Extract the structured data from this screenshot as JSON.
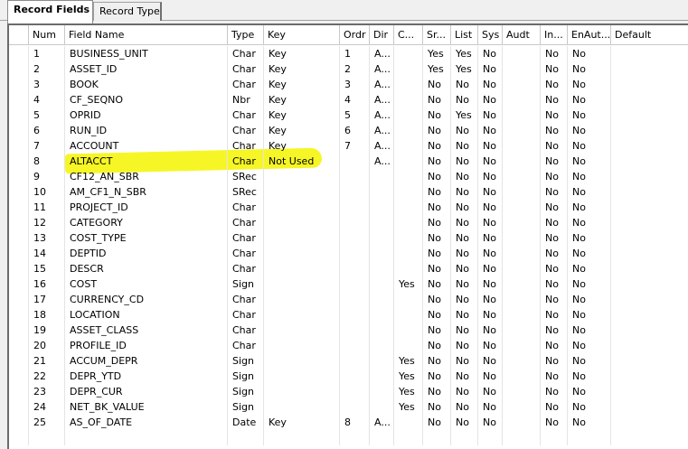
{
  "tabs": {
    "active": "Record Fields",
    "inactive": "Record Type"
  },
  "columns": [
    "Num",
    "Field Name",
    "Type",
    "Key",
    "Ordr",
    "Dir",
    "C...",
    "Sr...",
    "List",
    "Sys",
    "Audt",
    "In...",
    "EnAut...",
    "Default"
  ],
  "rows": [
    [
      "1",
      "BUSINESS_UNIT",
      "Char",
      "Key",
      "1",
      "A...",
      "",
      "Yes",
      "Yes",
      "No",
      "",
      "No",
      "No",
      ""
    ],
    [
      "2",
      "ASSET_ID",
      "Char",
      "Key",
      "2",
      "A...",
      "",
      "Yes",
      "Yes",
      "No",
      "",
      "No",
      "No",
      ""
    ],
    [
      "3",
      "BOOK",
      "Char",
      "Key",
      "3",
      "A...",
      "",
      "No",
      "No",
      "No",
      "",
      "No",
      "No",
      ""
    ],
    [
      "4",
      "CF_SEQNO",
      "Nbr",
      "Key",
      "4",
      "A...",
      "",
      "No",
      "No",
      "No",
      "",
      "No",
      "No",
      ""
    ],
    [
      "5",
      "OPRID",
      "Char",
      "Key",
      "5",
      "A...",
      "",
      "No",
      "Yes",
      "No",
      "",
      "No",
      "No",
      ""
    ],
    [
      "6",
      "RUN_ID",
      "Char",
      "Key",
      "6",
      "A...",
      "",
      "No",
      "No",
      "No",
      "",
      "No",
      "No",
      ""
    ],
    [
      "7",
      "ACCOUNT",
      "Char",
      "Key",
      "7",
      "A...",
      "",
      "No",
      "No",
      "No",
      "",
      "No",
      "No",
      ""
    ],
    [
      "8",
      "ALTACCT",
      "Char",
      "Not Used",
      "",
      "A...",
      "",
      "No",
      "No",
      "No",
      "",
      "No",
      "No",
      ""
    ],
    [
      "9",
      "CF12_AN_SBR",
      "SRec",
      "",
      "",
      "",
      "",
      "No",
      "No",
      "No",
      "",
      "No",
      "No",
      ""
    ],
    [
      "10",
      "AM_CF1_N_SBR",
      "SRec",
      "",
      "",
      "",
      "",
      "No",
      "No",
      "No",
      "",
      "No",
      "No",
      ""
    ],
    [
      "11",
      "PROJECT_ID",
      "Char",
      "",
      "",
      "",
      "",
      "No",
      "No",
      "No",
      "",
      "No",
      "No",
      ""
    ],
    [
      "12",
      "CATEGORY",
      "Char",
      "",
      "",
      "",
      "",
      "No",
      "No",
      "No",
      "",
      "No",
      "No",
      ""
    ],
    [
      "13",
      "COST_TYPE",
      "Char",
      "",
      "",
      "",
      "",
      "No",
      "No",
      "No",
      "",
      "No",
      "No",
      ""
    ],
    [
      "14",
      "DEPTID",
      "Char",
      "",
      "",
      "",
      "",
      "No",
      "No",
      "No",
      "",
      "No",
      "No",
      ""
    ],
    [
      "15",
      "DESCR",
      "Char",
      "",
      "",
      "",
      "",
      "No",
      "No",
      "No",
      "",
      "No",
      "No",
      ""
    ],
    [
      "16",
      "COST",
      "Sign",
      "",
      "",
      "",
      "Yes",
      "No",
      "No",
      "No",
      "",
      "No",
      "No",
      ""
    ],
    [
      "17",
      "CURRENCY_CD",
      "Char",
      "",
      "",
      "",
      "",
      "No",
      "No",
      "No",
      "",
      "No",
      "No",
      ""
    ],
    [
      "18",
      "LOCATION",
      "Char",
      "",
      "",
      "",
      "",
      "No",
      "No",
      "No",
      "",
      "No",
      "No",
      ""
    ],
    [
      "19",
      "ASSET_CLASS",
      "Char",
      "",
      "",
      "",
      "",
      "No",
      "No",
      "No",
      "",
      "No",
      "No",
      ""
    ],
    [
      "20",
      "PROFILE_ID",
      "Char",
      "",
      "",
      "",
      "",
      "No",
      "No",
      "No",
      "",
      "No",
      "No",
      ""
    ],
    [
      "21",
      "ACCUM_DEPR",
      "Sign",
      "",
      "",
      "",
      "Yes",
      "No",
      "No",
      "No",
      "",
      "No",
      "No",
      ""
    ],
    [
      "22",
      "DEPR_YTD",
      "Sign",
      "",
      "",
      "",
      "Yes",
      "No",
      "No",
      "No",
      "",
      "No",
      "No",
      ""
    ],
    [
      "23",
      "DEPR_CUR",
      "Sign",
      "",
      "",
      "",
      "Yes",
      "No",
      "No",
      "No",
      "",
      "No",
      "No",
      ""
    ],
    [
      "24",
      "NET_BK_VALUE",
      "Sign",
      "",
      "",
      "",
      "Yes",
      "No",
      "No",
      "No",
      "",
      "No",
      "No",
      ""
    ],
    [
      "25",
      "AS_OF_DATE",
      "Date",
      "Key",
      "8",
      "A...",
      "",
      "No",
      "No",
      "No",
      "",
      "No",
      "No",
      ""
    ]
  ],
  "highlight_color": "#f4f400"
}
